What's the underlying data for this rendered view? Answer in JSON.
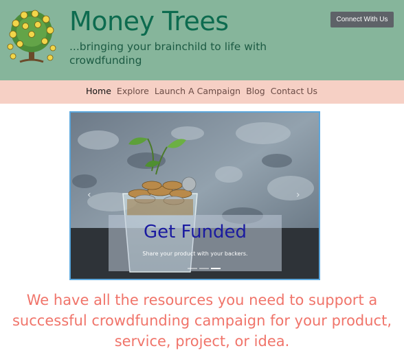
{
  "header": {
    "site_title": "Money Trees",
    "tagline": "...bringing your brainchild to life with crowdfunding",
    "connect_label": "Connect With Us",
    "logo_icon": "money-tree-icon"
  },
  "nav": {
    "items": [
      {
        "label": "Home",
        "active": true
      },
      {
        "label": "Explore"
      },
      {
        "label": "Launch A Campaign"
      },
      {
        "label": "Blog"
      },
      {
        "label": "Contact Us"
      }
    ]
  },
  "carousel": {
    "prev_icon": "chevron-left-icon",
    "next_icon": "chevron-right-icon",
    "caption_title": "Get Funded",
    "caption_subtitle": "Share your product with your backers.",
    "slide_count": 3,
    "active_slide": 2
  },
  "main": {
    "promo_text": "We have all the resources you need to support a successful crowdfunding campaign for your product, service, project, or idea."
  },
  "colors": {
    "header_bg": "#86b59b",
    "nav_bg": "#f6d0c5",
    "title": "#0d6b4f",
    "promo": "#f0746a",
    "caption_title": "#1a1aa0",
    "carousel_border": "#5aa6dc"
  }
}
